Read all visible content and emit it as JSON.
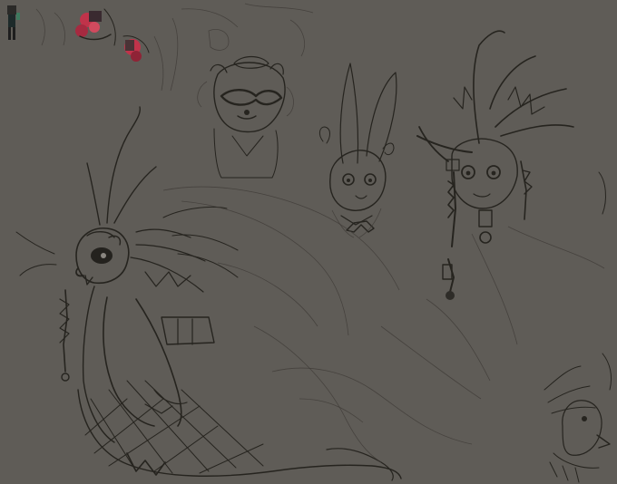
{
  "canvas": {
    "background": "#5f5c57",
    "ink": "#26241f",
    "accent_red": "#c0334a"
  },
  "sketches": [
    {
      "name": "raccoon-bust"
    },
    {
      "name": "rabbit-bust"
    },
    {
      "name": "feathered-bust"
    },
    {
      "name": "cloaked-creature"
    },
    {
      "name": "bird-sketch"
    },
    {
      "name": "thumbnail-row"
    }
  ]
}
